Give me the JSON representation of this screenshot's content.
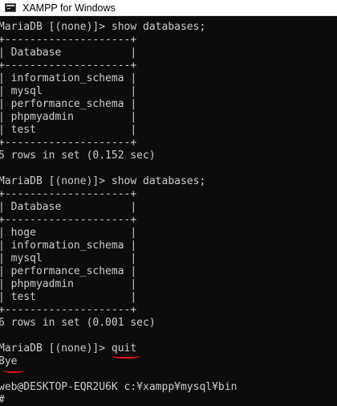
{
  "window": {
    "title": "XAMPP for Windows",
    "icon": "console-window-icon"
  },
  "console": {
    "lines": [
      "MariaDB [(none)]> show databases;",
      "+--------------------+",
      "| Database           |",
      "+--------------------+",
      "| information_schema |",
      "| mysql              |",
      "| performance_schema |",
      "| phpmyadmin         |",
      "| test               |",
      "+--------------------+",
      "5 rows in set (0.152 sec)",
      "",
      "MariaDB [(none)]> show databases;",
      "+--------------------+",
      "| Database           |",
      "+--------------------+",
      "| hoge               |",
      "| information_schema |",
      "| mysql              |",
      "| performance_schema |",
      "| phpmyadmin         |",
      "| test               |",
      "+--------------------+",
      "6 rows in set (0.001 sec)",
      "",
      "MariaDB [(none)]> quit",
      "Bye",
      "",
      "web@DESKTOP-EQR2U6K c:¥xampp¥mysql¥bin",
      "#"
    ]
  },
  "annotations": {
    "underline_color": "#e8111a",
    "underlined": [
      "quit",
      "Bye"
    ]
  }
}
